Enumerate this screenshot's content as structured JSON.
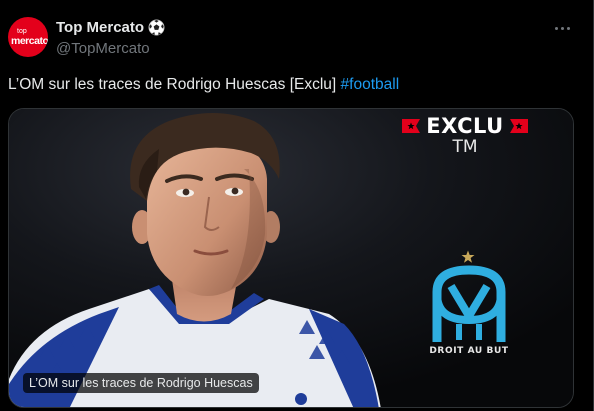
{
  "author": {
    "avatar_top": "top",
    "avatar_bottom": "mercato",
    "display_name": "Top Mercato",
    "handle": "@TopMercato"
  },
  "tweet": {
    "text": "L’OM sur les traces de Rodrigo Huescas [Exclu] ",
    "hashtag": "#football"
  },
  "media": {
    "badge_text": "EXCLU",
    "badge_sub": "TM",
    "club_motto": "DROIT AU BUT",
    "alt_caption": "L’OM sur les traces de Rodrigo Huescas"
  },
  "colors": {
    "background": "#000000",
    "accent_link": "#1d9bf0",
    "brand_red": "#e3001b",
    "om_blue": "#2faee0"
  },
  "icons": [
    "soccer-ball-icon",
    "more-icon",
    "flag-icon",
    "star-icon",
    "om-logo-icon"
  ]
}
